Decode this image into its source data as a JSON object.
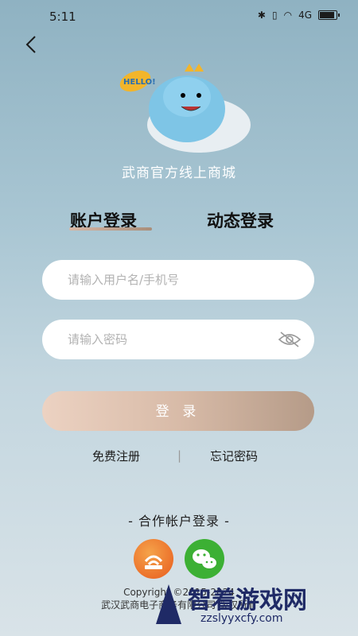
{
  "status_bar": {
    "time": "5:11",
    "signal_text": "4G"
  },
  "header": {
    "store_name": "武商官方线上商城",
    "mascot_text": "HELLO!"
  },
  "tabs": [
    {
      "label": "账户登录",
      "active": true
    },
    {
      "label": "动态登录",
      "active": false
    }
  ],
  "form": {
    "username_placeholder": "请输入用户名/手机号",
    "password_placeholder": "请输入密码",
    "login_label": "登 录"
  },
  "links": {
    "register": "免费注册",
    "divider": "|",
    "forgot": "忘记密码"
  },
  "partner": {
    "title": "- 合作帐户登录 -",
    "icons": [
      "company-wifi-icon",
      "wechat-icon"
    ]
  },
  "copyright": {
    "line1": "Copyright ©2015-2024",
    "line2": "武汉武商电子商务有限公司 版权所有"
  },
  "watermark": {
    "text": "智着游戏网",
    "url": "zzslyyxcfy.com"
  },
  "colors": {
    "accent": "#b59b88",
    "wechat": "#3cb034",
    "company": "#e85b1d",
    "bg_top": "#8fb2c2"
  }
}
